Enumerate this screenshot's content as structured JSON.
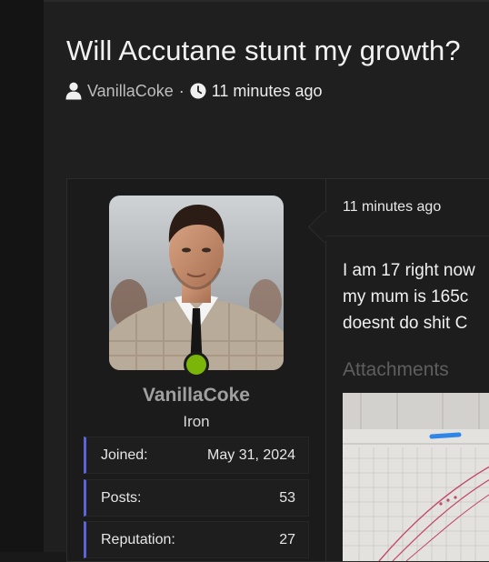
{
  "thread": {
    "title": "Will Accutane stunt my growth?",
    "author": "VanillaCoke",
    "separator": "·",
    "time_ago": "11 minutes ago"
  },
  "post": {
    "user": {
      "name": "VanillaCoke",
      "rank": "Iron",
      "online": true,
      "stats": [
        {
          "label": "Joined:",
          "value": "May 31, 2024"
        },
        {
          "label": "Posts:",
          "value": "53"
        },
        {
          "label": "Reputation:",
          "value": "27"
        }
      ]
    },
    "time_ago": "11 minutes ago",
    "body_lines": [
      "I am 17 right now",
      "my mum is 165c",
      "doesnt do shit C"
    ],
    "attachments_label": "Attachments"
  },
  "icons": [
    "user-icon",
    "clock-icon"
  ],
  "colors": {
    "background": "#1f1f1f",
    "online": "#7cb50a",
    "stat_accent": "#5a66d8",
    "muted_username": "#a0a0a0"
  }
}
